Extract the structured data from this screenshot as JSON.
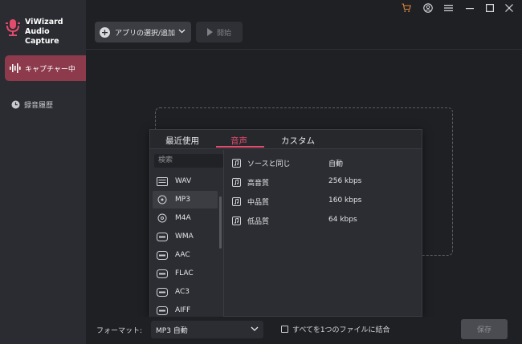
{
  "app": {
    "name_line1": "ViWizard",
    "name_line2": "Audio Capture"
  },
  "sidebar": {
    "items": [
      {
        "label": "キャプチャー中",
        "active": true
      },
      {
        "label": "録音履歴",
        "active": false
      }
    ]
  },
  "toolbar": {
    "add_label": "アプリの選択/追加",
    "start_label": "開始"
  },
  "popup": {
    "tabs": [
      {
        "label": "最近使用"
      },
      {
        "label": "音声",
        "active": true
      },
      {
        "label": "カスタム"
      }
    ],
    "search_placeholder": "検索",
    "formats": [
      {
        "label": "WAV"
      },
      {
        "label": "MP3",
        "selected": true
      },
      {
        "label": "M4A"
      },
      {
        "label": "WMA"
      },
      {
        "label": "AAC"
      },
      {
        "label": "FLAC"
      },
      {
        "label": "AC3"
      },
      {
        "label": "AIFF"
      }
    ],
    "qualities": [
      {
        "label": "ソースと同じ",
        "value": "自動"
      },
      {
        "label": "高音質",
        "value": "256 kbps"
      },
      {
        "label": "中品質",
        "value": "160 kbps"
      },
      {
        "label": "低品質",
        "value": "64 kbps"
      }
    ]
  },
  "bottom": {
    "format_label": "フォーマット:",
    "format_value": "MP3 自動",
    "merge_label": "すべてを1つのファイルに結合",
    "save_label": "保存"
  },
  "colors": {
    "accent": "#e24b6c",
    "sidebar_active": "#8c3a4c",
    "cart_icon": "#e0873a"
  },
  "icons": [
    "cart-icon",
    "account-icon",
    "menu-icon",
    "minimize-icon",
    "maximize-icon",
    "close-icon",
    "waveform-icon",
    "clock-icon",
    "music-note-icon"
  ]
}
